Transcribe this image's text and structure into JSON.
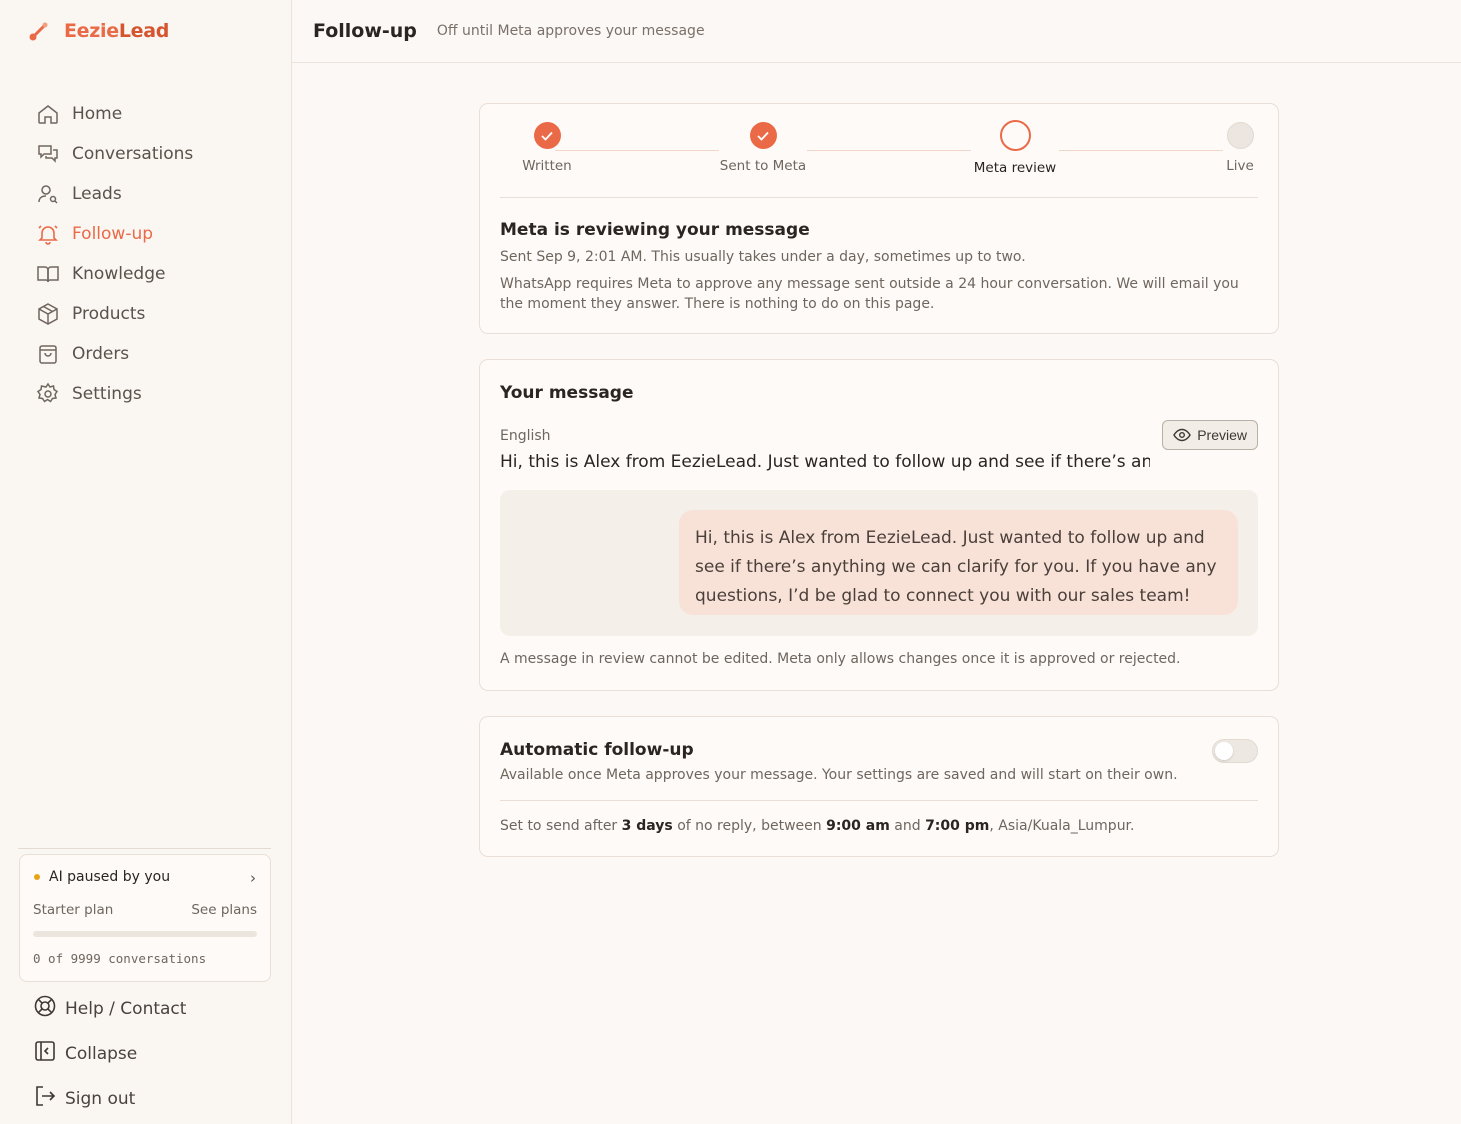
{
  "brand": {
    "part1": "Eezie",
    "part2": "Lead",
    "accent": "#ea6a47"
  },
  "sidebar": {
    "items": [
      {
        "label": "Home",
        "icon": "home-icon"
      },
      {
        "label": "Conversations",
        "icon": "chat-bubbles-icon"
      },
      {
        "label": "Leads",
        "icon": "user-search-icon"
      },
      {
        "label": "Follow-up",
        "icon": "bell-ring-icon",
        "active": true
      },
      {
        "label": "Knowledge",
        "icon": "book-open-icon"
      },
      {
        "label": "Products",
        "icon": "package-icon"
      },
      {
        "label": "Orders",
        "icon": "shopping-bag-icon"
      },
      {
        "label": "Settings",
        "icon": "gear-icon"
      }
    ],
    "plan": {
      "status": "AI paused by you",
      "plan_name": "Starter plan",
      "see_plans": "See plans",
      "usage": "0 of 9999 conversations",
      "usage_fraction": 0
    },
    "bottom": [
      {
        "label": "Help / Contact",
        "icon": "lifebuoy-icon"
      },
      {
        "label": "Collapse",
        "icon": "collapse-sidebar-icon"
      },
      {
        "label": "Sign out",
        "icon": "sign-out-icon"
      }
    ]
  },
  "header": {
    "title": "Follow-up",
    "subtitle": "Off until Meta approves your message"
  },
  "progress": {
    "steps": [
      {
        "label": "Written",
        "state": "done"
      },
      {
        "label": "Sent to Meta",
        "state": "done"
      },
      {
        "label": "Meta review",
        "state": "current"
      },
      {
        "label": "Live",
        "state": "todo"
      }
    ],
    "title": "Meta is reviewing your message",
    "sent_info": "Sent Sep 9, 2:01 AM. This usually takes under a day, sometimes up to two.",
    "description": "WhatsApp requires Meta to approve any message sent outside a 24 hour conversation. We will email you the moment they answer. There is nothing to do on this page."
  },
  "message": {
    "title": "Your message",
    "language": "English",
    "preview_label": "Preview",
    "truncated": "Hi, this is Alex from EezieLead. Just wanted to follow up and see if there’s anythi...",
    "full_text": "Hi, this is Alex from EezieLead. Just wanted to follow up and see if there’s anything we can clarify for you. If you have any questions, I’d be glad to connect you with our sales team!",
    "note": "A message in review cannot be edited. Meta only allows changes once it is approved or rejected."
  },
  "auto_followup": {
    "title": "Automatic follow-up",
    "subtitle": "Available once Meta approves your message. Your settings are saved and will start on their own.",
    "enabled": false,
    "schedule": {
      "prefix": "Set to send after",
      "delay": "3 days",
      "mid": "of no reply, between",
      "start": "9:00 am",
      "and": "and",
      "end": "7:00 pm",
      "timezone": ", Asia/Kuala_Lumpur."
    }
  }
}
